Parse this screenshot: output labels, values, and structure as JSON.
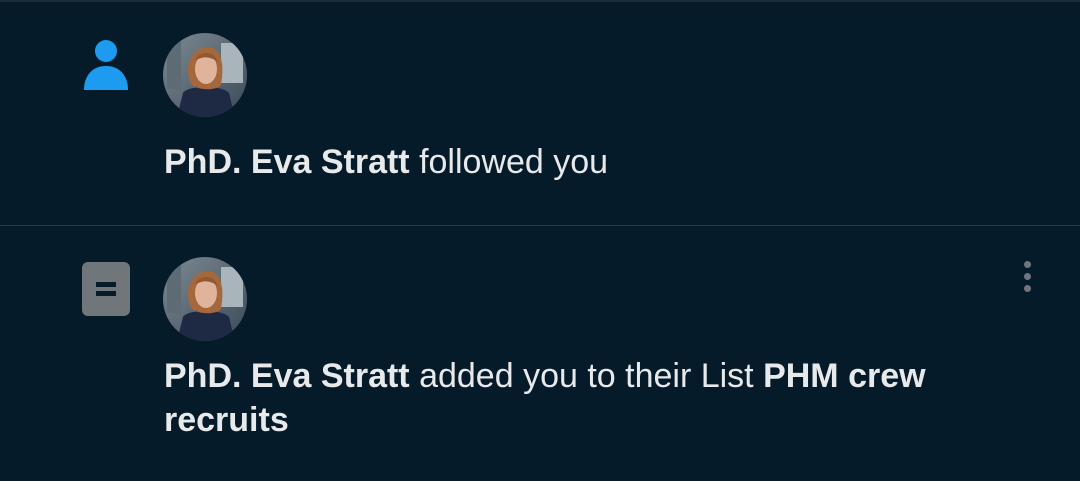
{
  "notifications": [
    {
      "type_icon": "person-icon",
      "user_name": "PhD. Eva Stratt",
      "action_text": " followed you",
      "list_name": ""
    },
    {
      "type_icon": "list-icon",
      "user_name": "PhD. Eva Stratt",
      "action_text": " added you to their List ",
      "list_name": "PHM crew recruits",
      "more_icon": "more-vertical-icon"
    }
  ],
  "colors": {
    "background": "#061b2a",
    "text": "#e7e9ea",
    "accent": "#1d9bf0",
    "muted_icon": "#71767b"
  }
}
